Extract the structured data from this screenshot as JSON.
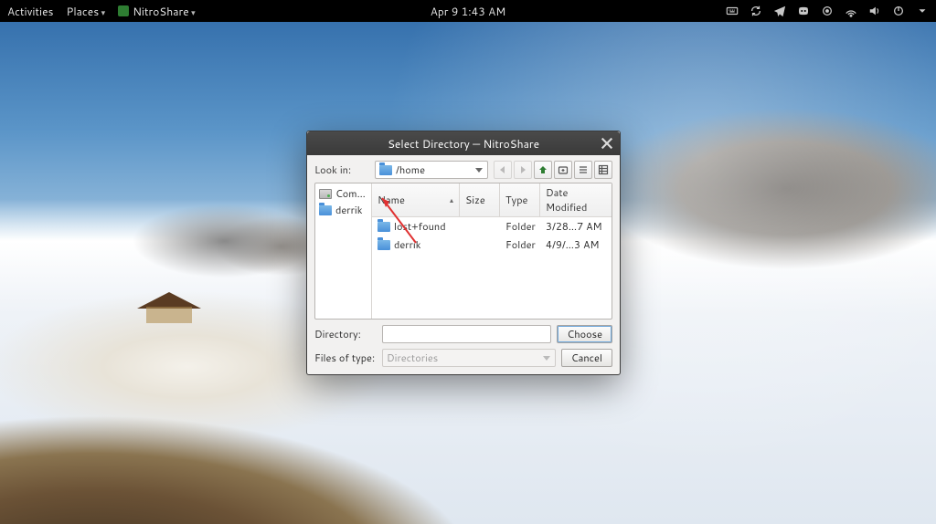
{
  "topbar": {
    "activities": "Activities",
    "places": "Places",
    "app_name": "NitroShare",
    "clock": "Apr 9  1:43 AM"
  },
  "dialog": {
    "title": "Select Directory — NitroShare",
    "look_in_label": "Look in:",
    "path": "/home",
    "places": {
      "computer": "Com…",
      "user": "derrik"
    },
    "columns": {
      "name": "Name",
      "size": "Size",
      "type": "Type",
      "date": "Date Modified"
    },
    "rows": [
      {
        "name": "lost+found",
        "size": "",
        "type": "Folder",
        "date": "3/28…7 AM"
      },
      {
        "name": "derrik",
        "size": "",
        "type": "Folder",
        "date": "4/9/…3 AM"
      }
    ],
    "directory_label": "Directory:",
    "directory_value": "",
    "files_of_type_label": "Files of type:",
    "files_of_type_value": "Directories",
    "choose": "Choose",
    "cancel": "Cancel"
  }
}
